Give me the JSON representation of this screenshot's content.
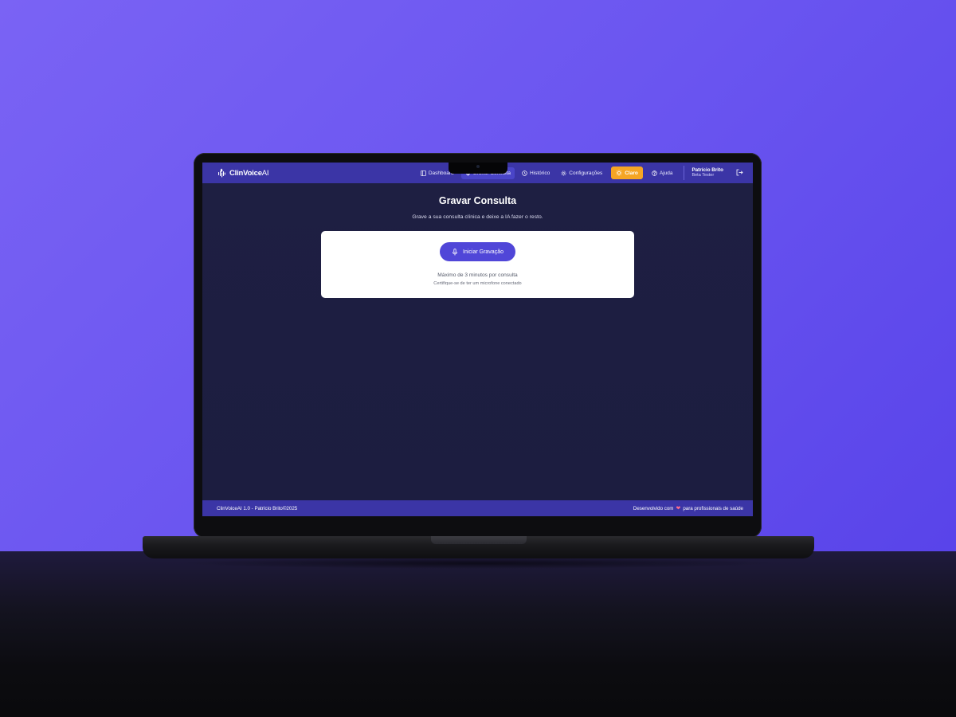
{
  "app": {
    "brand_name": "ClinVoice",
    "brand_suffix": "AI"
  },
  "nav": {
    "items": [
      {
        "label": "Dashboard",
        "icon": "layout-icon",
        "active": false
      },
      {
        "label": "Gravar Consulta",
        "icon": "mic-icon",
        "active": true
      },
      {
        "label": "Histórico",
        "icon": "history-icon",
        "active": false
      },
      {
        "label": "Configurações",
        "icon": "gear-icon",
        "active": false
      }
    ],
    "theme_label": "Claro",
    "help_label": "Ajuda"
  },
  "user": {
    "name": "Patrício Brito",
    "role": "Beta Tester"
  },
  "page": {
    "title": "Gravar Consulta",
    "subtitle": "Grave a sua consulta clínica e deixe a IA fazer o resto."
  },
  "recorder": {
    "button_label": "Iniciar Gravação",
    "limit_text": "Máximo de 3 minutos por consulta",
    "hint_text": "Certifique-se de ter um microfone conectado"
  },
  "footer": {
    "left": "ClinVoiceAI 1.0 - Patrício Brito©2025",
    "right_prefix": "Desenvolvido com",
    "right_suffix": "para profissionais de saúde"
  },
  "colors": {
    "background": "#6a55f0",
    "topbar": "#3b35a6",
    "screen_bg": "#1c1d3e",
    "accent_button": "#5046d8",
    "theme_button": "#f5a524",
    "heart": "#ff6b8a"
  }
}
